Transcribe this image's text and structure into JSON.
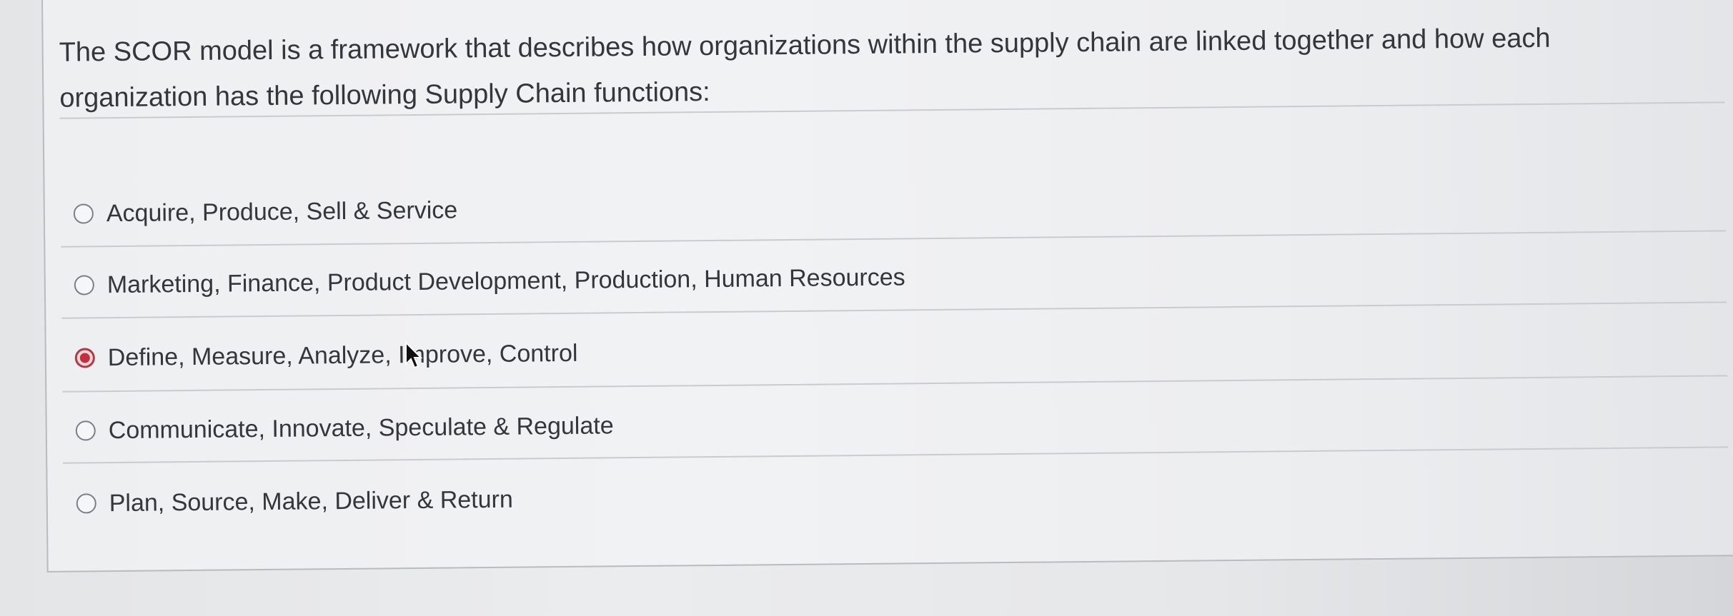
{
  "question": {
    "text": "The SCOR model is a framework that describes how organizations within the supply chain are linked together and how each organization has the following Supply Chain functions:"
  },
  "options": [
    {
      "label": "Acquire, Produce, Sell & Service",
      "selected": false
    },
    {
      "label": "Marketing, Finance, Product Development, Production, Human Resources",
      "selected": false
    },
    {
      "label": "Define, Measure, Analyze, Improve, Control",
      "selected": true
    },
    {
      "label": "Communicate, Innovate, Speculate & Regulate",
      "selected": false
    },
    {
      "label": "Plan, Source, Make, Deliver & Return",
      "selected": false
    }
  ],
  "colors": {
    "selected_accent": "#c0303f",
    "text": "#33363b"
  },
  "icons": {
    "cursor": "mouse-pointer-icon"
  }
}
